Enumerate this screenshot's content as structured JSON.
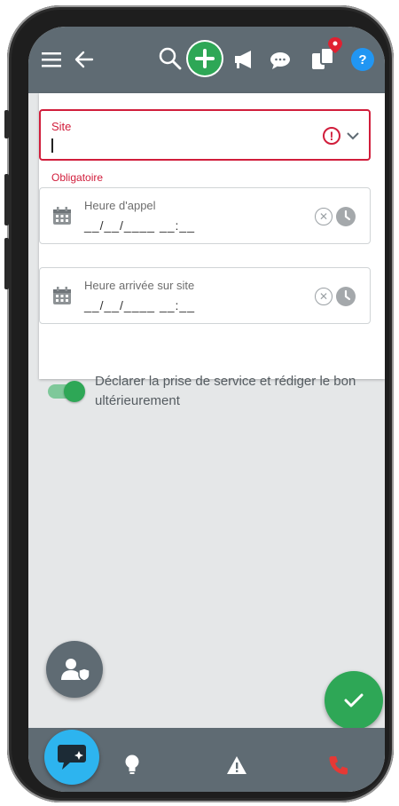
{
  "form": {
    "site_label": "Site",
    "site_helper": "Obligatoire",
    "heure_appel_label": "Heure d'appel",
    "heure_appel_mask": "__/__/____ __:__",
    "heure_arrivee_label": "Heure arrivée sur site",
    "heure_arrivee_mask": "__/__/____ __:__"
  },
  "toggle": {
    "label": "Déclarer la prise de service et rédiger le bon ultérieurement",
    "checked": true
  },
  "icons": {
    "topbar": [
      "menu-icon",
      "back-arrow-icon",
      "search-icon",
      "add-icon",
      "megaphone-icon",
      "chat-icon",
      "notification-location-icon",
      "help-icon"
    ],
    "bottombar": [
      "chat-fab-icon",
      "lightbulb-icon",
      "warning-icon",
      "phone-icon"
    ]
  },
  "colors": {
    "topbar": "#5f6b73",
    "error": "#d11d3b",
    "success": "#2ea756",
    "chat_fab": "#2db4ef",
    "help": "#2196f3"
  }
}
